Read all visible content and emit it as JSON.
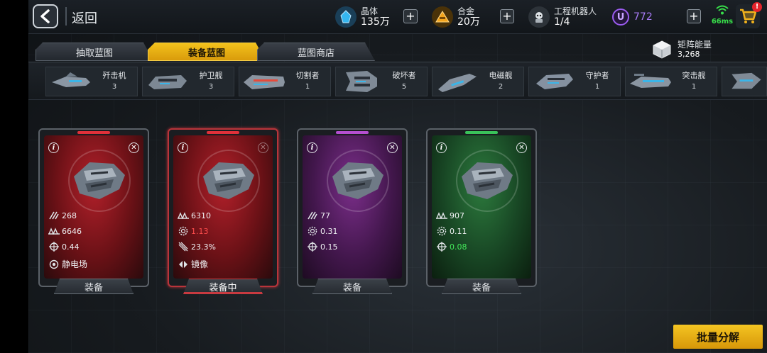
{
  "header": {
    "back_label": "返回",
    "resources": [
      {
        "name": "crystal",
        "label": "晶体",
        "value": "135万",
        "icon": "crystal-icon",
        "color": "#2aa8e8"
      },
      {
        "name": "alloy",
        "label": "合金",
        "value": "20万",
        "icon": "alloy-icon",
        "color": "#f0a219"
      },
      {
        "name": "robot",
        "label": "工程机器人",
        "value": "1/4",
        "icon": "robot-icon",
        "color": "#d8dde2"
      }
    ],
    "currency": {
      "symbol": "U",
      "value": "772",
      "color": "#9b5cf0"
    },
    "ping": "66ms",
    "cart_badge": "!"
  },
  "tabs": [
    {
      "label": "抽取蓝图",
      "active": false
    },
    {
      "label": "装备蓝图",
      "active": true
    },
    {
      "label": "蓝图商店",
      "active": false
    }
  ],
  "matrix_energy": {
    "label": "矩阵能量",
    "value": "3,268"
  },
  "ship_categories": [
    {
      "name": "歼击机",
      "count": "3"
    },
    {
      "name": "护卫舰",
      "count": "3"
    },
    {
      "name": "切割者",
      "count": "1"
    },
    {
      "name": "破坏者",
      "count": "5"
    },
    {
      "name": "电磁舰",
      "count": "2"
    },
    {
      "name": "守护者",
      "count": "1"
    },
    {
      "name": "突击舰",
      "count": "1"
    }
  ],
  "cards": [
    {
      "rarity": "red",
      "rarity_color": "#e0313a",
      "stats": [
        {
          "icon": "speed-icon",
          "value": "268",
          "tone": ""
        },
        {
          "icon": "armor-icon",
          "value": "6646",
          "tone": ""
        },
        {
          "icon": "target-icon",
          "value": "0.44",
          "tone": ""
        },
        {
          "icon": "static-field-icon",
          "value": "静电场",
          "tone": ""
        }
      ],
      "button": "装备",
      "equipped": false
    },
    {
      "rarity": "red",
      "rarity_color": "#e0313a",
      "stats": [
        {
          "icon": "armor-icon",
          "value": "6310",
          "tone": ""
        },
        {
          "icon": "gear-icon",
          "value": "1.13",
          "tone": "red"
        },
        {
          "icon": "boost-icon",
          "value": "23.3%",
          "tone": ""
        },
        {
          "icon": "mirror-icon",
          "value": "镜像",
          "tone": ""
        }
      ],
      "button": "装备中",
      "equipped": true
    },
    {
      "rarity": "purple",
      "rarity_color": "#b44fd0",
      "stats": [
        {
          "icon": "speed-icon",
          "value": "77",
          "tone": ""
        },
        {
          "icon": "gear-icon",
          "value": "0.31",
          "tone": ""
        },
        {
          "icon": "target-icon",
          "value": "0.15",
          "tone": ""
        }
      ],
      "button": "装备",
      "equipped": false
    },
    {
      "rarity": "green",
      "rarity_color": "#3ac25a",
      "stats": [
        {
          "icon": "armor-icon",
          "value": "907",
          "tone": ""
        },
        {
          "icon": "gear-icon",
          "value": "0.11",
          "tone": ""
        },
        {
          "icon": "target-icon",
          "value": "0.08",
          "tone": "green"
        }
      ],
      "button": "装备",
      "equipped": false
    }
  ],
  "bulk_button": "批量分解"
}
